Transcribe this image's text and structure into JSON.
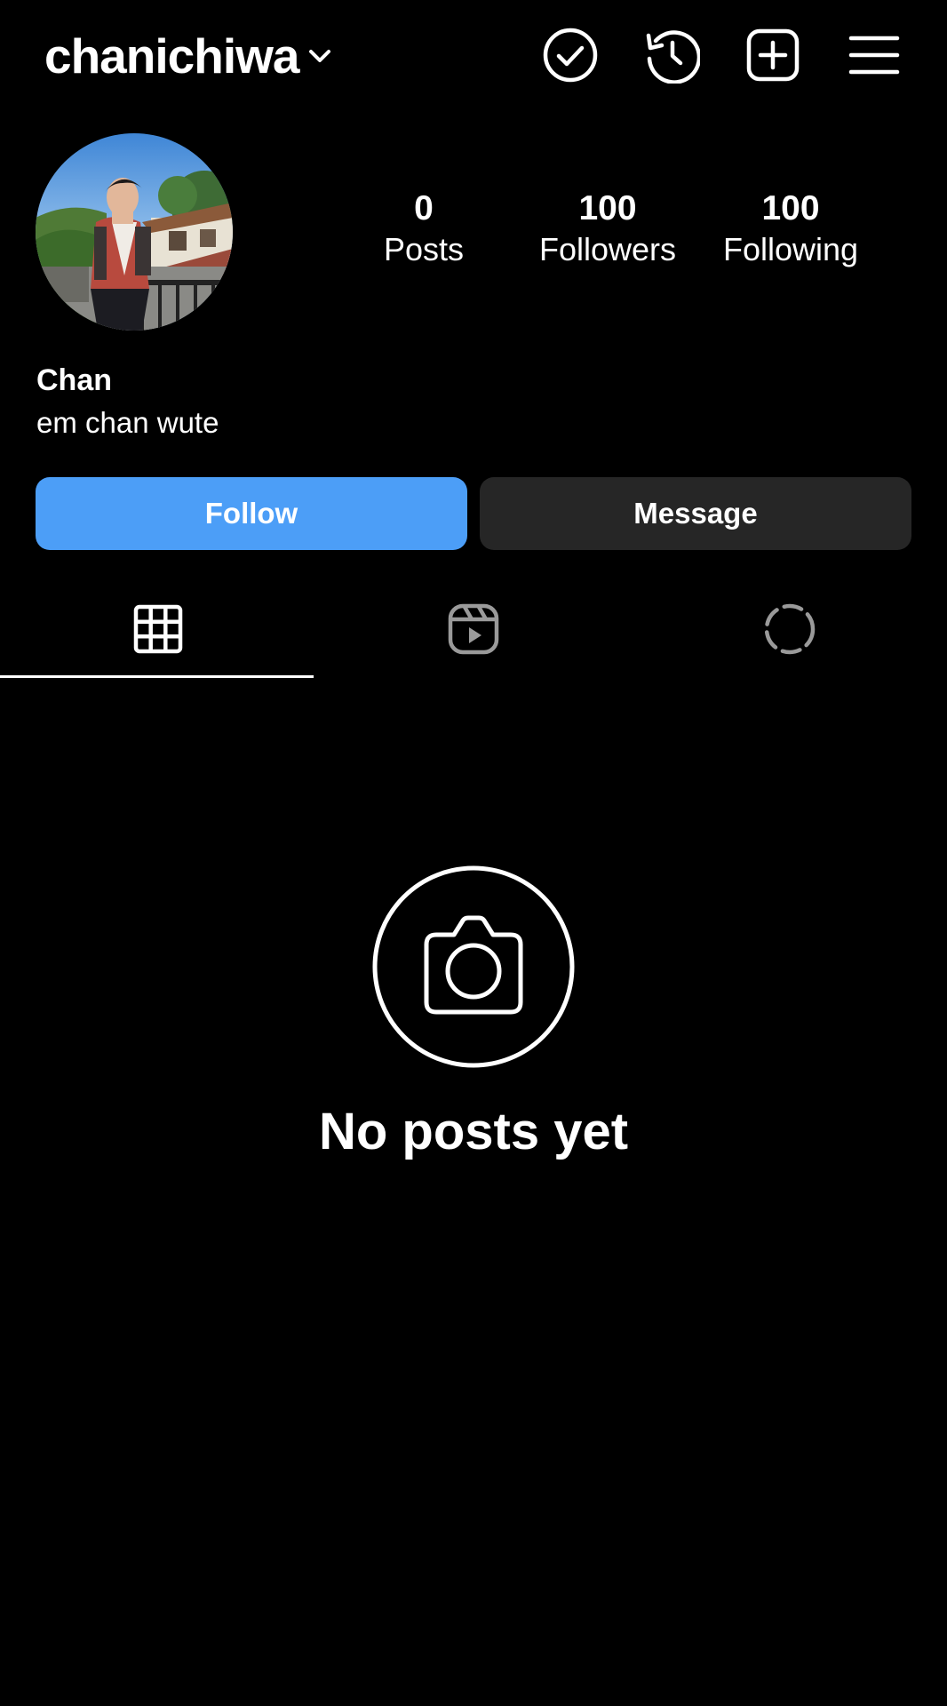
{
  "header": {
    "username": "chanichiwa",
    "icons": [
      "chevron-down-icon",
      "check-circle-icon",
      "history-icon",
      "add-square-icon",
      "menu-icon"
    ]
  },
  "profile": {
    "display_name": "Chan",
    "bio": "em chan wute",
    "avatar": "profile-photo",
    "stats": [
      {
        "value": "0",
        "label": "Posts"
      },
      {
        "value": "100",
        "label": "Followers"
      },
      {
        "value": "100",
        "label": "Following"
      }
    ]
  },
  "actions": {
    "follow_label": "Follow",
    "message_label": "Message"
  },
  "tabs": [
    {
      "icon": "grid-icon",
      "active": true
    },
    {
      "icon": "reels-icon",
      "active": false
    },
    {
      "icon": "dashed-circle-icon",
      "active": false
    }
  ],
  "empty_state": {
    "icon": "camera-icon",
    "text": "No posts yet"
  },
  "colors": {
    "background": "#000000",
    "follow_button": "#4c9ef7",
    "message_button": "#262626",
    "text": "#ffffff"
  }
}
